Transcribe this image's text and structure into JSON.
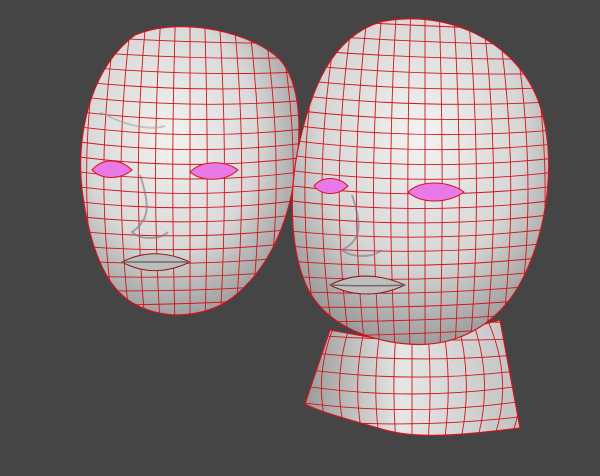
{
  "viewport": {
    "background": "#454545",
    "objects": [
      {
        "name": "face-mask",
        "kind": "mesh"
      },
      {
        "name": "head-with-neck",
        "kind": "mesh"
      }
    ]
  },
  "colors": {
    "surface_light": "#ececec",
    "surface_mid": "#c9c9c9",
    "surface_dark": "#8e8e8e",
    "wireframe": "#d3141b",
    "eye_socket": "#e879e6"
  }
}
